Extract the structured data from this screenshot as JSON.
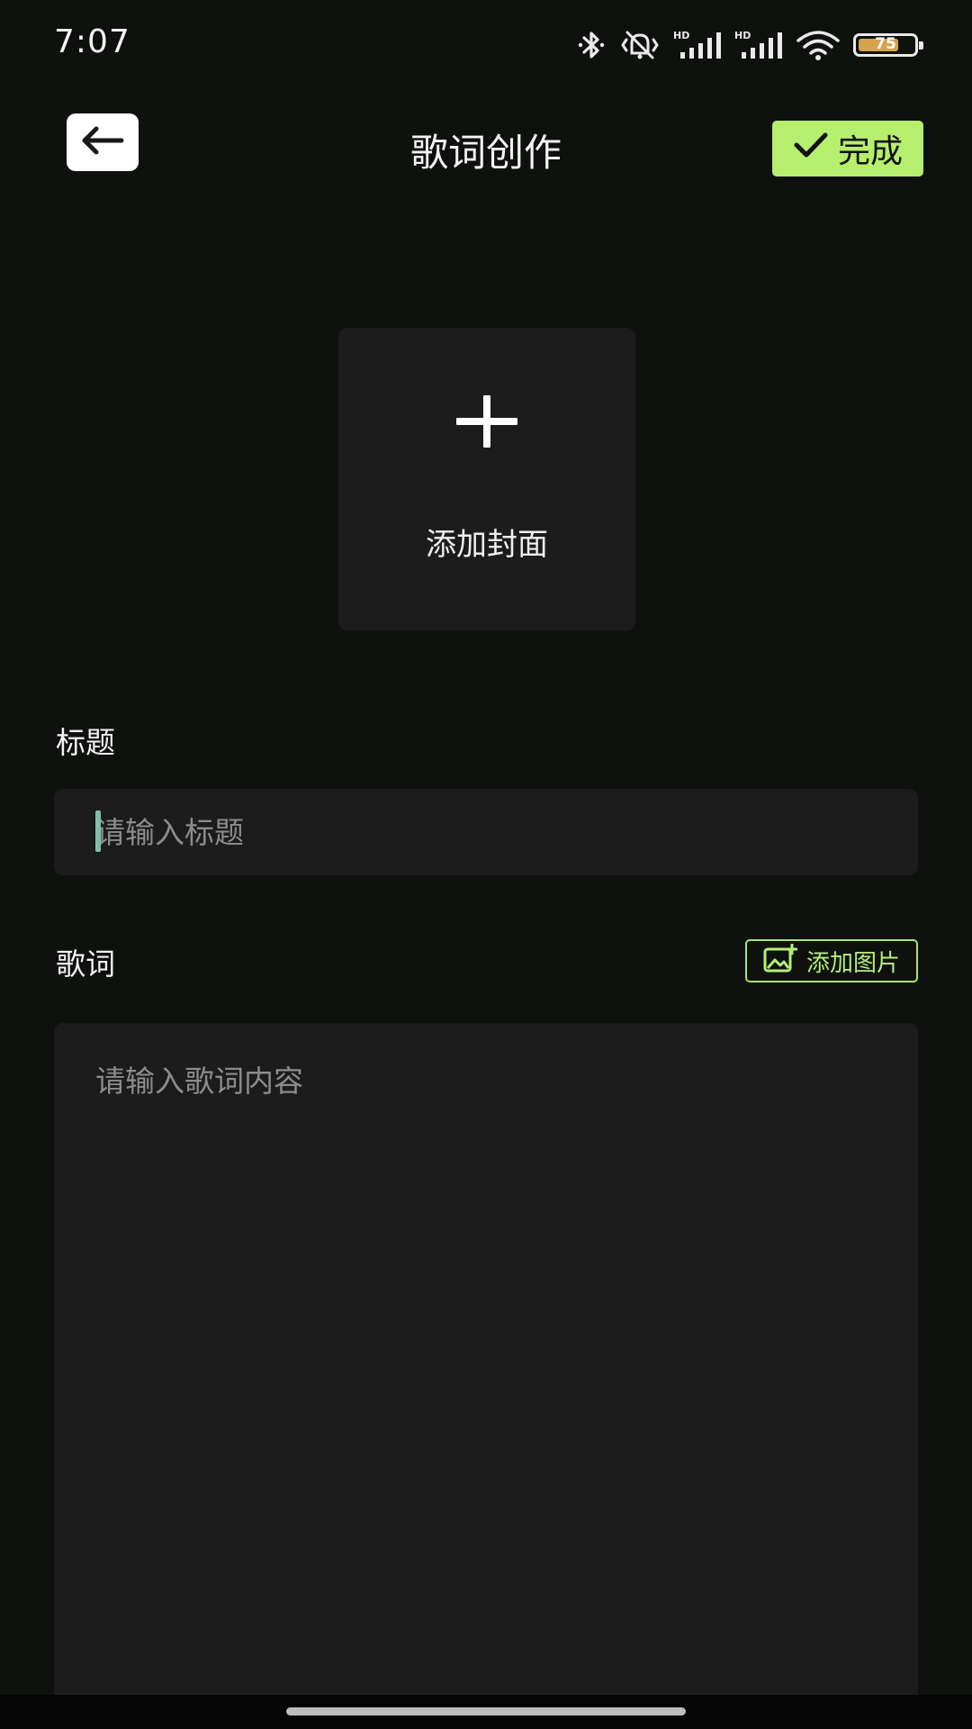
{
  "status_bar": {
    "time": "7:07",
    "battery_level": "75",
    "battery_fraction": 0.75,
    "icons": [
      "bluetooth-icon",
      "vibrate-off-icon",
      "hd-signal-icon",
      "hd-signal-icon",
      "wifi-icon",
      "battery-icon"
    ],
    "signal_label": "HD"
  },
  "header": {
    "title": "歌词创作",
    "done_label": "完成",
    "back_icon": "arrow-left-icon",
    "done_icon": "check-icon"
  },
  "cover": {
    "label": "添加封面",
    "icon": "plus-icon"
  },
  "title_section": {
    "label": "标题",
    "placeholder": "请输入标题",
    "value": ""
  },
  "lyrics_section": {
    "label": "歌词",
    "add_image_label": "添加图片",
    "add_image_icon": "image-add-icon",
    "placeholder": "请输入歌词内容",
    "value": ""
  },
  "colors": {
    "background": "#0f110f",
    "surface": "#1b1c1b",
    "accent": "#b6ee6e",
    "placeholder": "#8c8c8c"
  }
}
